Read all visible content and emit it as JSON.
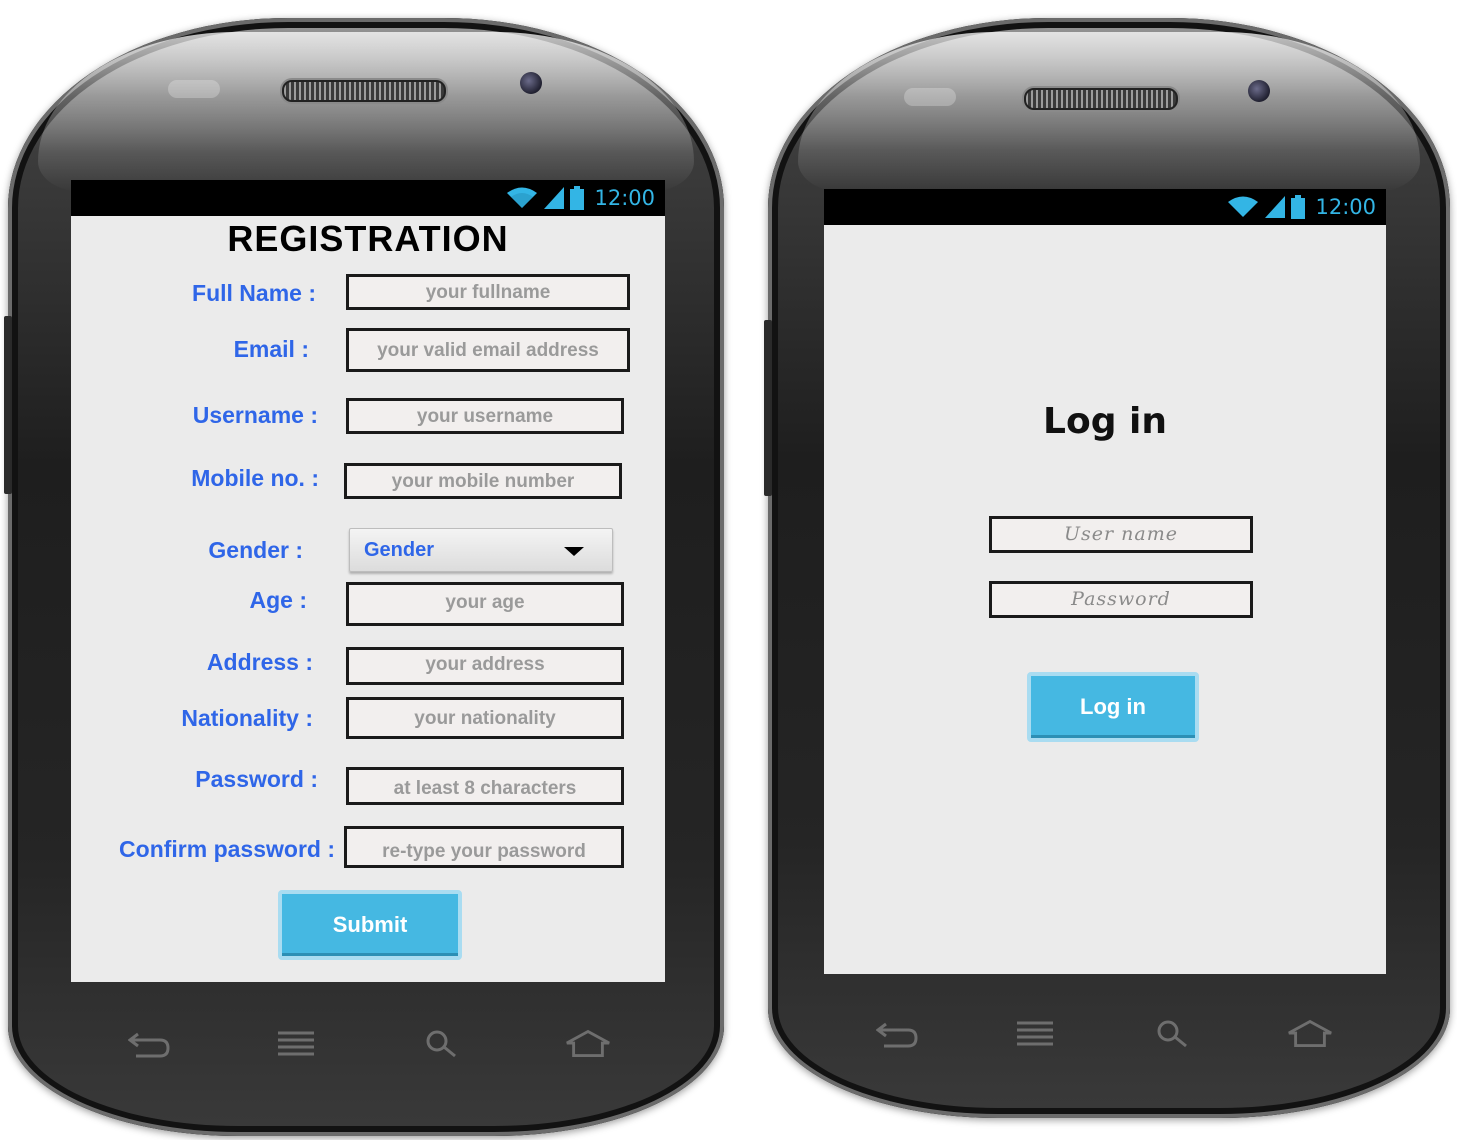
{
  "status_bar": {
    "time": "12:00"
  },
  "registration": {
    "title": "REGISTRATION",
    "fields": [
      {
        "label": "Full Name :",
        "placeholder": "your fullname"
      },
      {
        "label": "Email :",
        "placeholder": "your valid email address"
      },
      {
        "label": "Username :",
        "placeholder": "your username"
      },
      {
        "label": "Mobile no. :",
        "placeholder": "your mobile number"
      },
      {
        "label": "Gender :",
        "selected": "Gender"
      },
      {
        "label": "Age :",
        "placeholder": "your age"
      },
      {
        "label": "Address :",
        "placeholder": "your address"
      },
      {
        "label": "Nationality :",
        "placeholder": "your nationality"
      },
      {
        "label": "Password :",
        "placeholder": "at least 8 characters"
      },
      {
        "label": "Confirm password :",
        "placeholder": "re-type your password"
      }
    ],
    "submit_label": "Submit"
  },
  "login": {
    "title": "Log in",
    "username_placeholder": "User name",
    "password_placeholder": "Password",
    "button_label": "Log in"
  },
  "colors": {
    "label": "#2f66e8",
    "button": "#45b8e2",
    "status_icons": "#33b5e5"
  },
  "icons": [
    "wifi-icon",
    "signal-icon",
    "battery-icon",
    "back-icon",
    "recent-apps-icon",
    "search-icon",
    "home-icon"
  ]
}
